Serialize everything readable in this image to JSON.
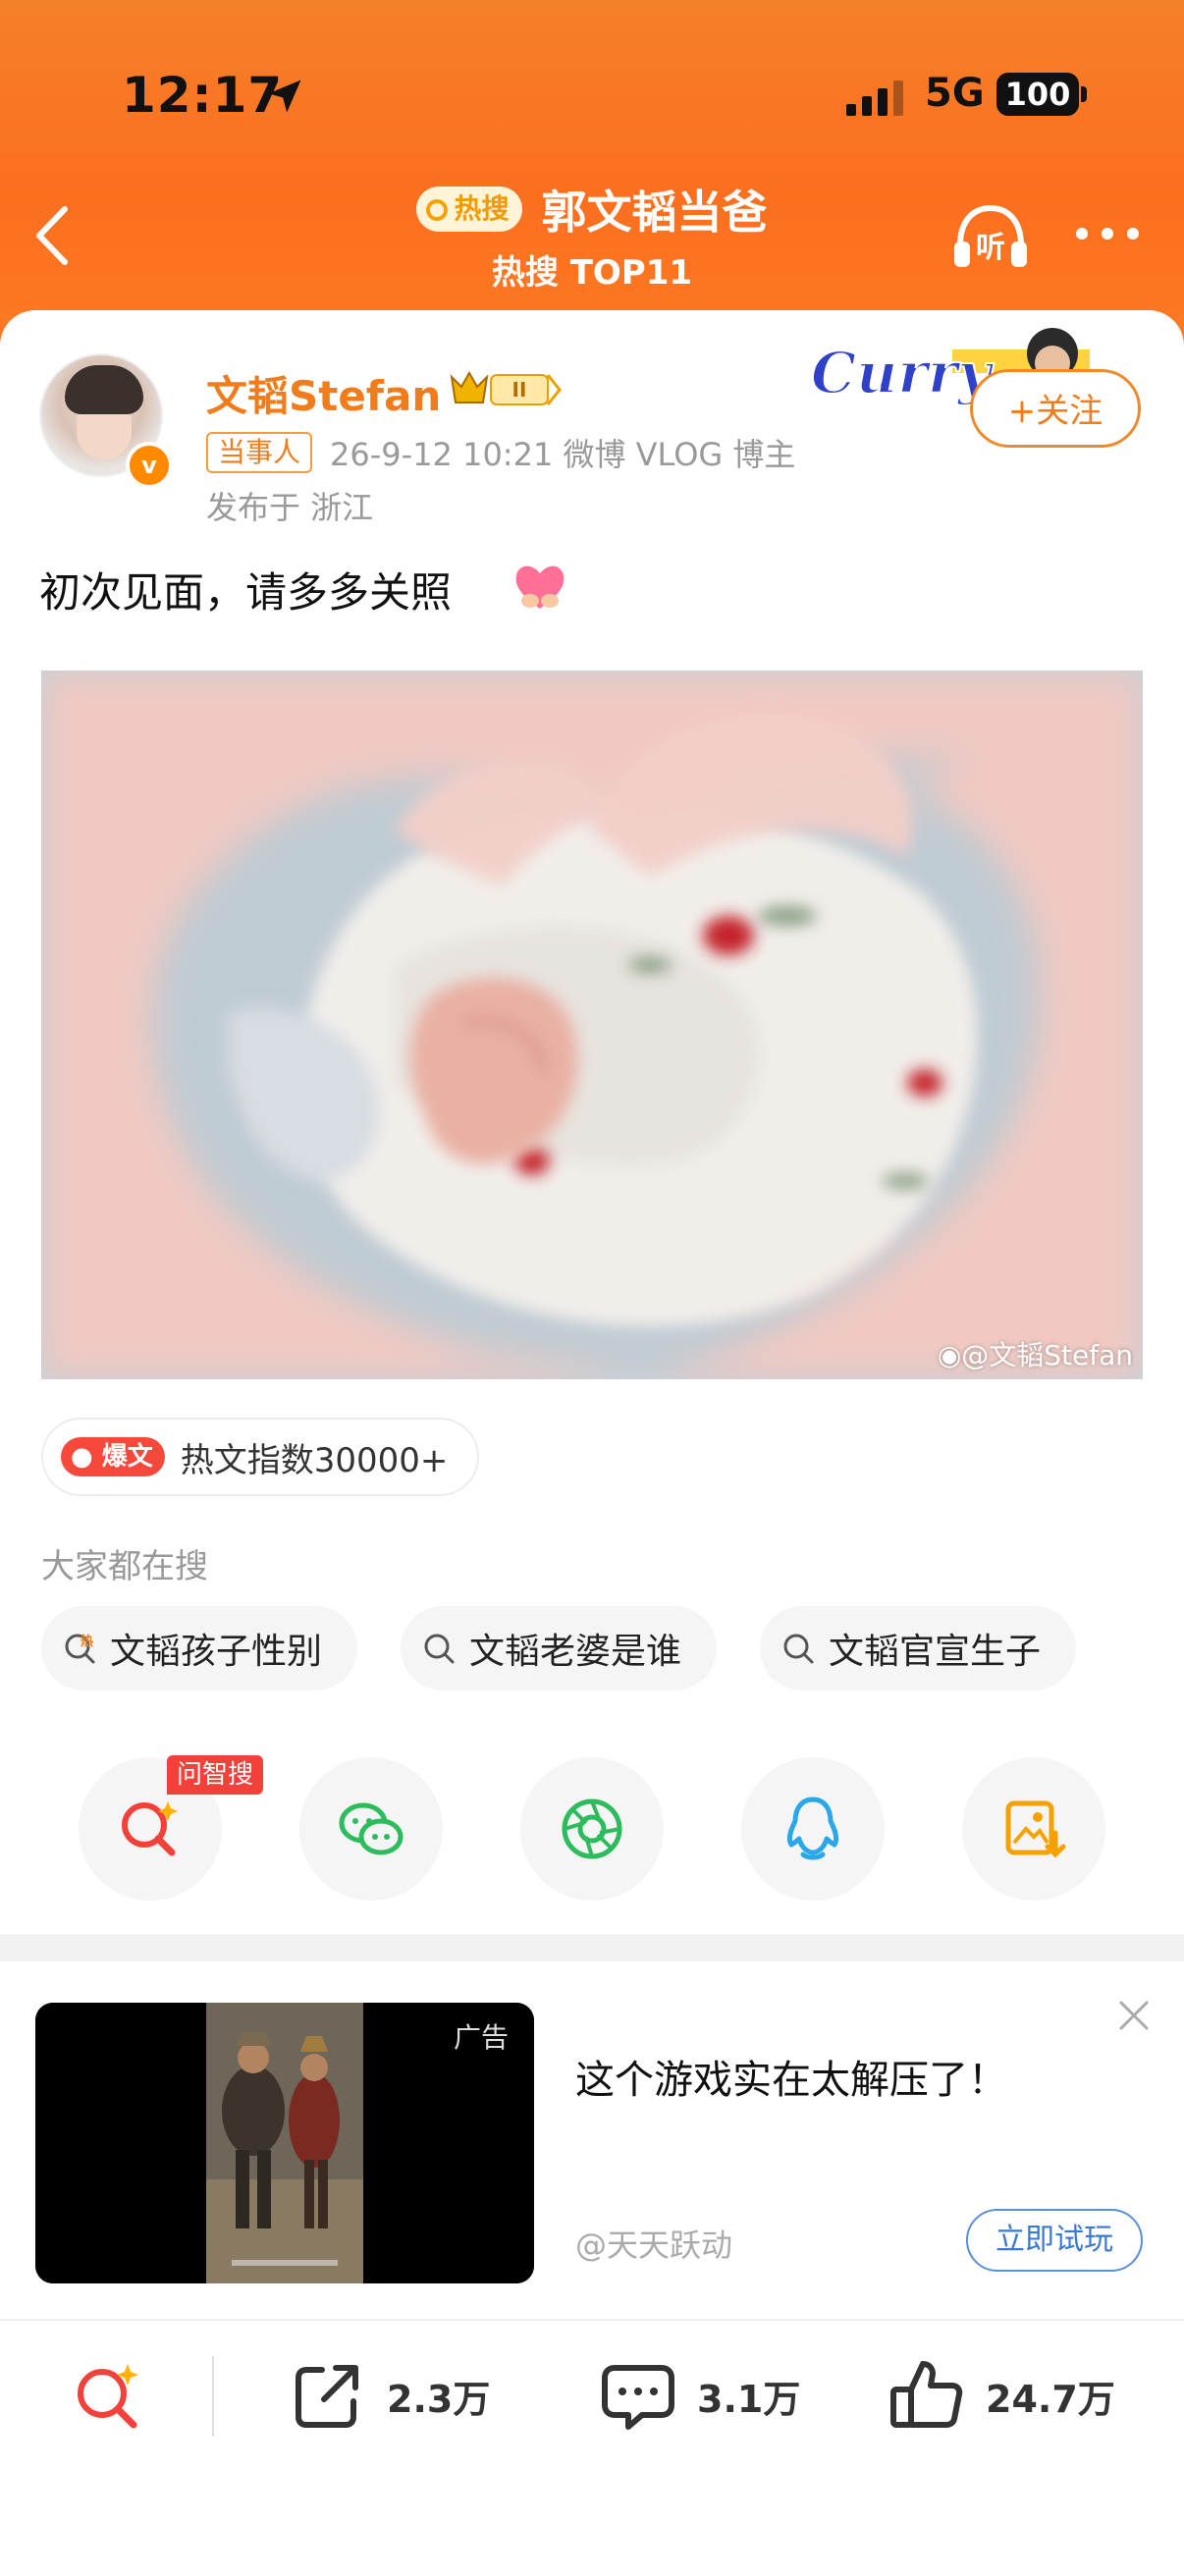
{
  "status_bar": {
    "time": "12:17",
    "network": "5G",
    "battery": "100"
  },
  "nav": {
    "hot_badge": "热搜",
    "title": "郭文韬当爸",
    "subtitle": "热搜 TOP11"
  },
  "post": {
    "username": "文韬Stefan",
    "level": "II",
    "party_badge": "当事人",
    "meta": "26-9-12 10:21  微博 VLOG 博主",
    "location": "发布于 浙江",
    "follow_label": "+关注",
    "deco_text": "Curry",
    "text": "初次见面，请多多关照",
    "photo_watermark": "@文韬Stefan",
    "hot_tag": "爆文",
    "hot_index": "热文指数30000+"
  },
  "related": {
    "title": "大家都在搜",
    "chips": [
      {
        "label": "文韬孩子性别",
        "hot": true
      },
      {
        "label": "文韬老婆是谁",
        "hot": false
      },
      {
        "label": "文韬官宣生子",
        "hot": false
      }
    ]
  },
  "share": {
    "ask_tag": "问智搜"
  },
  "ad": {
    "tag": "广告",
    "title": "这个游戏实在太解压了！",
    "brand": "@天天跃动",
    "button": "立即试玩"
  },
  "bottom_bar": {
    "repost": "2.3万",
    "comment": "3.1万",
    "like": "24.7万"
  },
  "colors": {
    "accent": "#f07c1b",
    "header": "#fb6f1f",
    "ad_button": "#3b78cf"
  }
}
